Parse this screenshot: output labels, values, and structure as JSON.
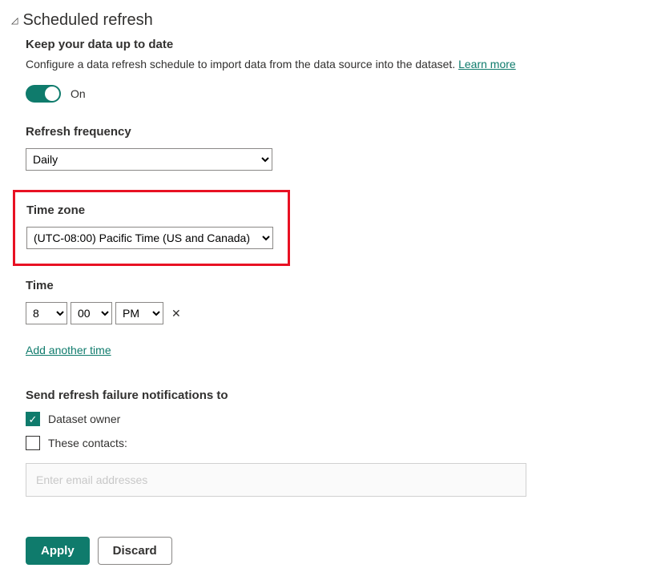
{
  "section": {
    "title": "Scheduled refresh",
    "subtitle": "Keep your data up to date",
    "description": "Configure a data refresh schedule to import data from the data source into the dataset. ",
    "learn_more": "Learn more"
  },
  "toggle": {
    "state": "On"
  },
  "frequency": {
    "label": "Refresh frequency",
    "value": "Daily"
  },
  "timezone": {
    "label": "Time zone",
    "value": "(UTC-08:00) Pacific Time (US and Canada)"
  },
  "time": {
    "label": "Time",
    "hour": "8",
    "minute": "00",
    "ampm": "PM"
  },
  "add_time": "Add another time",
  "notifications": {
    "label": "Send refresh failure notifications to",
    "owner_label": "Dataset owner",
    "contacts_label": "These contacts:",
    "email_placeholder": "Enter email addresses"
  },
  "buttons": {
    "apply": "Apply",
    "discard": "Discard"
  }
}
